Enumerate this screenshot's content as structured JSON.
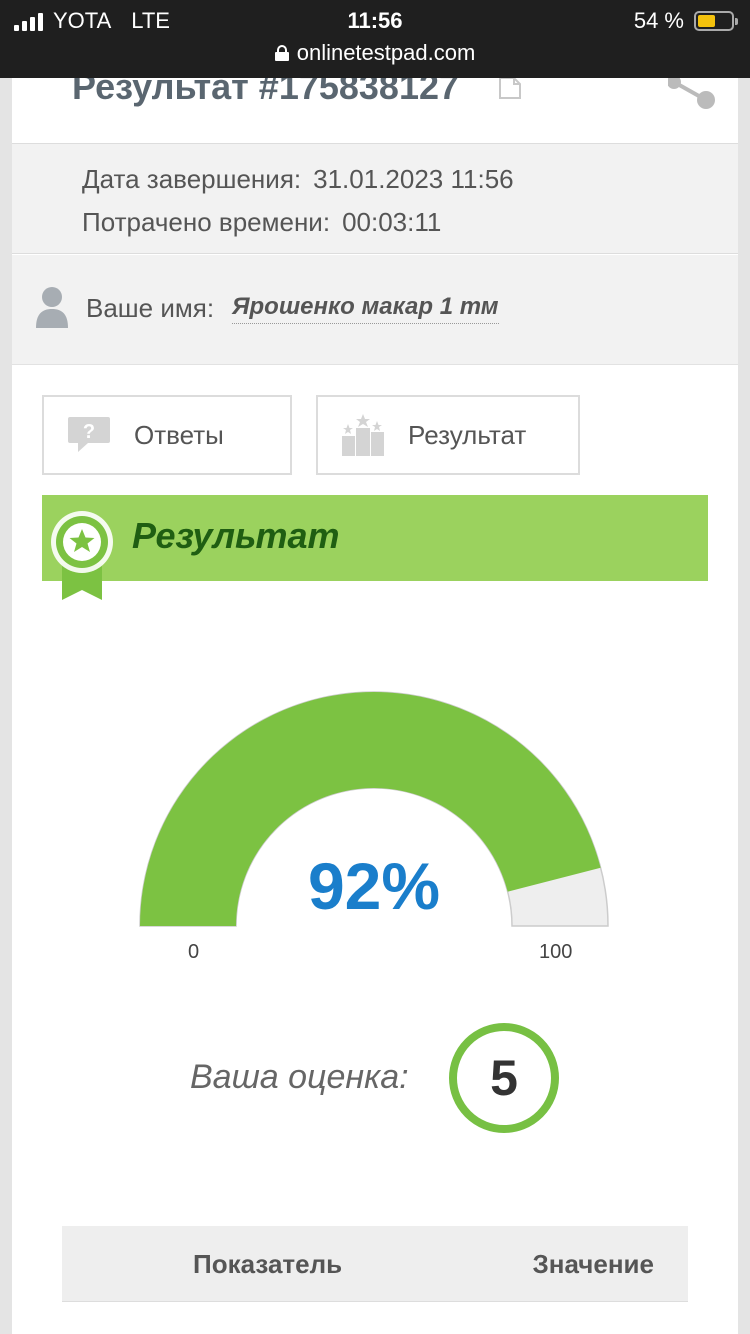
{
  "status_bar": {
    "carrier": "YOTA",
    "network": "LTE",
    "time": "11:56",
    "battery_percent": "54 %",
    "battery_level": 0.54,
    "url": "onlinetestpad.com"
  },
  "header": {
    "title": "Результат #175838127",
    "icons": [
      "copy-icon",
      "share-icon"
    ]
  },
  "meta": {
    "completion_label": "Дата завершения:",
    "completion_value": "31.01.2023 11:56",
    "time_spent_label": "Потрачено времени:",
    "time_spent_value": "00:03:11"
  },
  "user": {
    "name_label": "Ваше имя:",
    "name_value": "Ярошенко макар 1 тм"
  },
  "tabs": [
    {
      "label": "Ответы",
      "icon": "question-bubble-icon"
    },
    {
      "label": "Результат",
      "icon": "podium-icon"
    }
  ],
  "banner": {
    "title": "Результат",
    "icon": "award-badge-icon"
  },
  "gauge": {
    "value": 92,
    "display": "92%",
    "min_label": "0",
    "max_label": "100",
    "fill_color": "#7cc242",
    "track_color": "#eeeeee",
    "value_color": "#1a7ecb"
  },
  "grade": {
    "label": "Ваша оценка:",
    "value": "5",
    "ring_color": "#77c043"
  },
  "table": {
    "headers": [
      "Показатель",
      "Значение"
    ]
  }
}
